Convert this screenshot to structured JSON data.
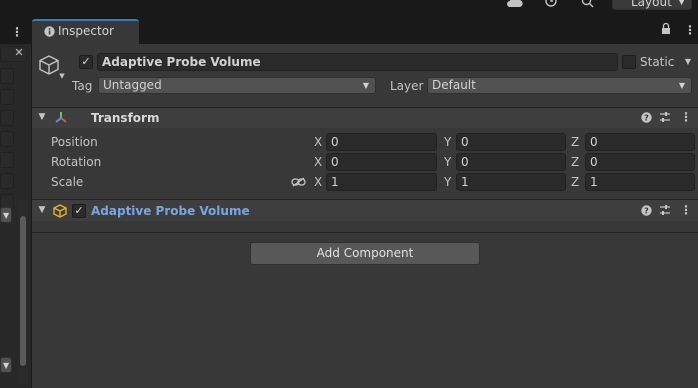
{
  "topbar": {
    "layout_label": "Layout"
  },
  "tab": {
    "label": "Inspector"
  },
  "object": {
    "name": "Adaptive Probe Volume",
    "active": true,
    "static_label": "Static",
    "tag_label": "Tag",
    "tag_value": "Untagged",
    "layer_label": "Layer",
    "layer_value": "Default"
  },
  "transform": {
    "title": "Transform",
    "rows": [
      {
        "label": "Position",
        "x": "0",
        "y": "0",
        "z": "0"
      },
      {
        "label": "Rotation",
        "x": "0",
        "y": "0",
        "z": "0"
      },
      {
        "label": "Scale",
        "x": "1",
        "y": "1",
        "z": "1"
      }
    ],
    "axis_x": "X",
    "axis_y": "Y",
    "axis_z": "Z"
  },
  "component": {
    "title": "Adaptive Probe Volume",
    "enabled": true
  },
  "add_component_label": "Add Component",
  "colors": {
    "accent": "#3a79bb",
    "component_title": "#7aa6e0",
    "panel": "#383838"
  }
}
